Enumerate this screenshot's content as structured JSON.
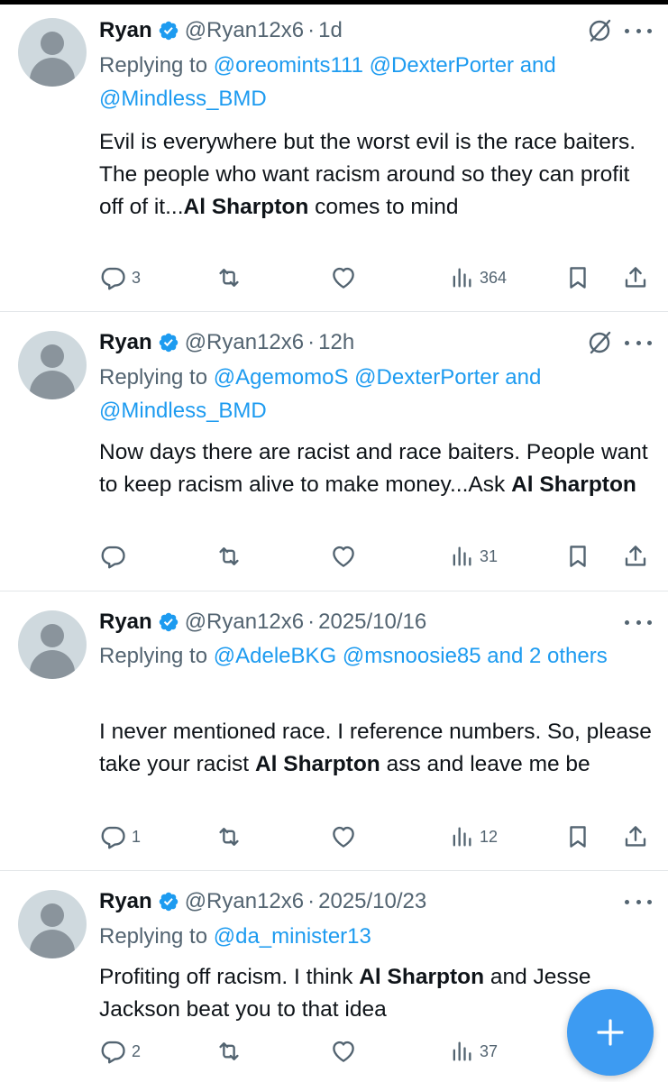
{
  "tweets": [
    {
      "name": "Ryan",
      "handle": "@Ryan12x6",
      "time": "1d",
      "replying_prefix": "Replying to ",
      "replying_mentions": "@oreomints111 @DexterPorter and @Mindless_BMD",
      "text_before": "Evil is everywhere but the worst evil is the race baiters. The people who want racism around so they can profit off of it...",
      "text_bold": "Al Sharpton",
      "text_after": " comes to mind",
      "replies": "3",
      "views": "364"
    },
    {
      "name": "Ryan",
      "handle": "@Ryan12x6",
      "time": "12h",
      "replying_prefix": "Replying to ",
      "replying_mentions": "@AgemomoS @DexterPorter and @Mindless_BMD",
      "text_before": "Now days there are racist and race baiters. People want to keep racism alive to make money...Ask ",
      "text_bold": "Al Sharpton",
      "text_after": "",
      "replies": "",
      "views": "31"
    },
    {
      "name": "Ryan",
      "handle": "@Ryan12x6",
      "time": "2025/10/16",
      "replying_prefix": "Replying to ",
      "replying_mentions": "@AdeleBKG @msnoosie85 and 2 others",
      "text_before": "I never mentioned race. I reference numbers. So, please take your racist ",
      "text_bold": "Al Sharpton",
      "text_after": " ass and leave me be",
      "replies": "1",
      "views": "12"
    },
    {
      "name": "Ryan",
      "handle": "@Ryan12x6",
      "time": "2025/10/23",
      "replying_prefix": "Replying to ",
      "replying_mentions": "@da_minister13",
      "text_before": "Profiting off racism. I think ",
      "text_bold": "Al Sharpton",
      "text_after": " and Jesse Jackson beat you to that idea",
      "replies": "2",
      "views": "37"
    }
  ],
  "dot_separator": "·",
  "icons": {
    "verified": "verified-badge-icon",
    "grok": "grok-icon",
    "more": "more-icon",
    "reply": "reply-icon",
    "retweet": "retweet-icon",
    "like": "like-icon",
    "views": "views-icon",
    "bookmark": "bookmark-icon",
    "share": "share-icon",
    "compose": "compose-plus-icon"
  },
  "colors": {
    "accent": "#1d9bf0",
    "secondary_text": "#536471",
    "fab": "#3d9bf2"
  }
}
